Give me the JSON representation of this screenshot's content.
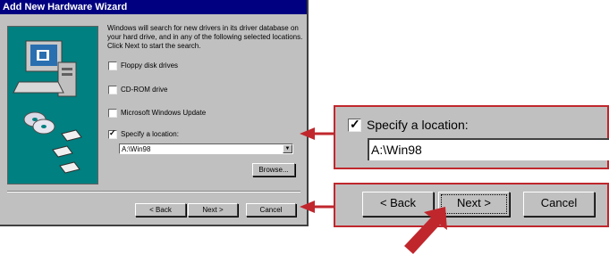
{
  "wizard": {
    "title": "Add New Hardware Wizard",
    "intro": "Windows will search for new drivers in its driver database on your hard drive, and in any of the following selected locations. Click Next to start the search.",
    "options": [
      {
        "label": "Floppy disk drives",
        "checked": false
      },
      {
        "label": "CD-ROM drive",
        "checked": false
      },
      {
        "label": "Microsoft Windows Update",
        "checked": false
      },
      {
        "label": "Specify a location:",
        "checked": true
      }
    ],
    "location_value": "A:\\Win98",
    "browse_label": "Browse...",
    "back_label": "< Back",
    "next_label": "Next >",
    "cancel_label": "Cancel"
  },
  "zoom_location": {
    "label": "Specify a location:",
    "value": "A:\\Win98"
  },
  "zoom_buttons": {
    "back_label": "< Back",
    "next_label": "Next >",
    "cancel_label": "Cancel"
  },
  "colors": {
    "callout_red": "#c0272d",
    "titlebar": "#000080",
    "panel_teal": "#008080"
  }
}
